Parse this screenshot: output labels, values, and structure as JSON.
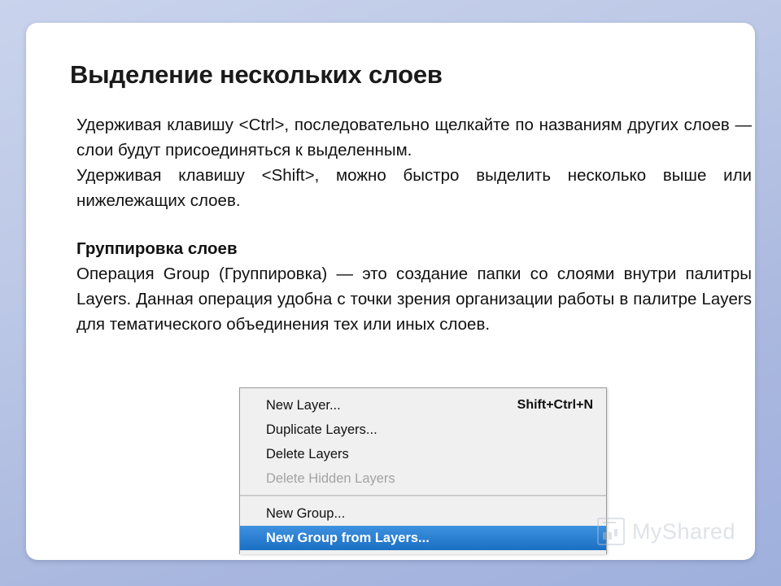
{
  "slide": {
    "title": "Выделение нескольких слоев",
    "paragraphs": [
      {
        "id": "p1",
        "text": "Удерживая клавишу <Ctrl>, последовательно щелкайте по названиям других слоев — слои будут присоединяться к выделенным."
      },
      {
        "id": "p2",
        "text": "Удерживая клавишу <Shift>, можно быстро выделить несколько выше или нижележащих слоев."
      },
      {
        "id": "p3",
        "text": "Группировка слоев",
        "bold": true
      },
      {
        "id": "p4",
        "text": "Операция Group (Группировка) — это создание папки со слоями внутри палитры Layers. Данная операция удобна с точки зрения организации работы в палитре Layers для тематического объединения тех или иных слоев."
      }
    ]
  },
  "context_menu": {
    "groups": [
      {
        "items": [
          {
            "label": "New Layer...",
            "shortcut": "Shift+Ctrl+N",
            "state": "normal"
          },
          {
            "label": "Duplicate Layers...",
            "shortcut": "",
            "state": "normal"
          },
          {
            "label": "Delete Layers",
            "shortcut": "",
            "state": "normal"
          },
          {
            "label": "Delete Hidden Layers",
            "shortcut": "",
            "state": "disabled"
          }
        ]
      },
      {
        "items": [
          {
            "label": "New Group...",
            "shortcut": "",
            "state": "normal"
          },
          {
            "label": "New Group from Layers...",
            "shortcut": "",
            "state": "highlight"
          }
        ]
      }
    ],
    "highlight_color": "#1a6fc4"
  },
  "watermark": {
    "text": "MyShared"
  }
}
